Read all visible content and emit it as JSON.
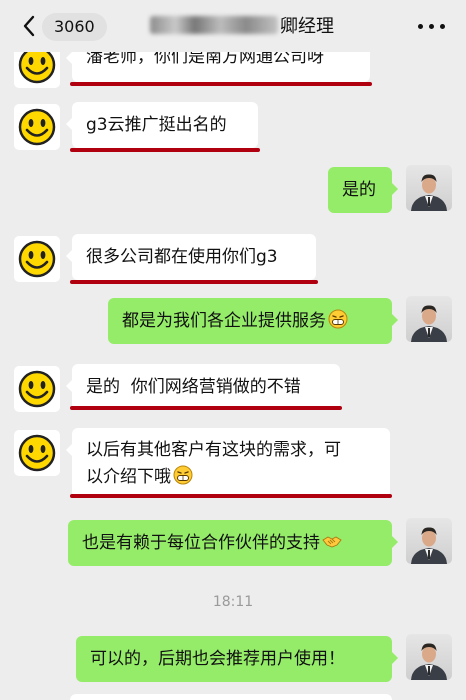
{
  "header": {
    "badge": "3060",
    "title_suffix": "卿经理"
  },
  "messages": [
    {
      "side": "left",
      "text": "潘老师，你们是南方网通公司呀"
    },
    {
      "side": "left",
      "text": "g3云推广挺出名的"
    },
    {
      "side": "right",
      "text": "是的"
    },
    {
      "side": "left",
      "text": "很多公司都在使用你们g3"
    },
    {
      "side": "right",
      "text": "都是为我们各企业提供服务",
      "emoji": "grin-emoji"
    },
    {
      "side": "left",
      "text": "是的  你们网络营销做的不错"
    },
    {
      "side": "left",
      "text_line1": "以后有其他客户有这块的需求，可",
      "text_line2": "以介绍下哦",
      "emoji": "grin-emoji"
    },
    {
      "side": "right",
      "text": "也是有赖于每位合作伙伴的支持",
      "emoji": "handshake-emoji"
    },
    {
      "side": "right",
      "text": "可以的，后期也会推荐用户使用！"
    }
  ],
  "timestamp": "18:11",
  "colors": {
    "background": "#ededed",
    "bubble_right": "#95ec69",
    "bubble_left": "#ffffff",
    "underline": "#b00010"
  }
}
